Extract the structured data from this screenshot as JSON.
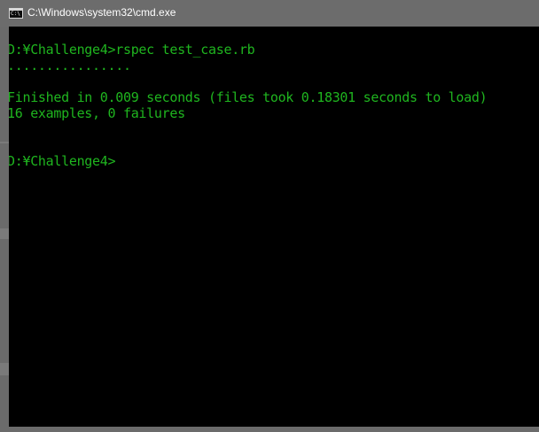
{
  "window": {
    "title": "C:\\Windows\\system32\\cmd.exe",
    "icon": "cmd-icon",
    "icon_glyph": "C:\\",
    "console_text_color": "#1fb51f",
    "console_background": "#000000"
  },
  "console": {
    "lines": [
      "D:¥Challenge4>rspec test_case.rb",
      "................",
      "",
      "Finished in 0.009 seconds (files took 0.18301 seconds to load)",
      "16 examples, 0 failures",
      "",
      "",
      "D:¥Challenge4>"
    ]
  }
}
